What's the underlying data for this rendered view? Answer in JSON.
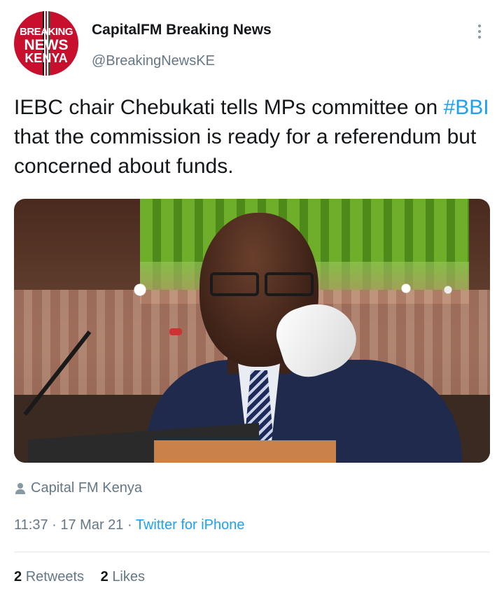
{
  "author": {
    "avatar_text": [
      "BREAKING",
      "NEWS",
      "KENYA"
    ],
    "name": "CapitalFM Breaking News",
    "handle": "@BreakingNewsKE"
  },
  "tweet": {
    "text_before": "IEBC chair Chebukati tells MPs committee on ",
    "hashtag": "#BBI",
    "text_after": " that the commission is ready for a referendum but concerned about funds."
  },
  "media": {
    "credit_icon": "person-icon",
    "credit": "Capital FM Kenya"
  },
  "meta": {
    "time": "11:37",
    "separator": "·",
    "date": "17 Mar 21",
    "source": "Twitter for iPhone"
  },
  "stats": {
    "retweets_count": "2",
    "retweets_label": "Retweets",
    "likes_count": "2",
    "likes_label": "Likes"
  },
  "colors": {
    "link": "#1da1f2",
    "secondary_text": "#657786",
    "avatar_red": "#c8102e"
  }
}
